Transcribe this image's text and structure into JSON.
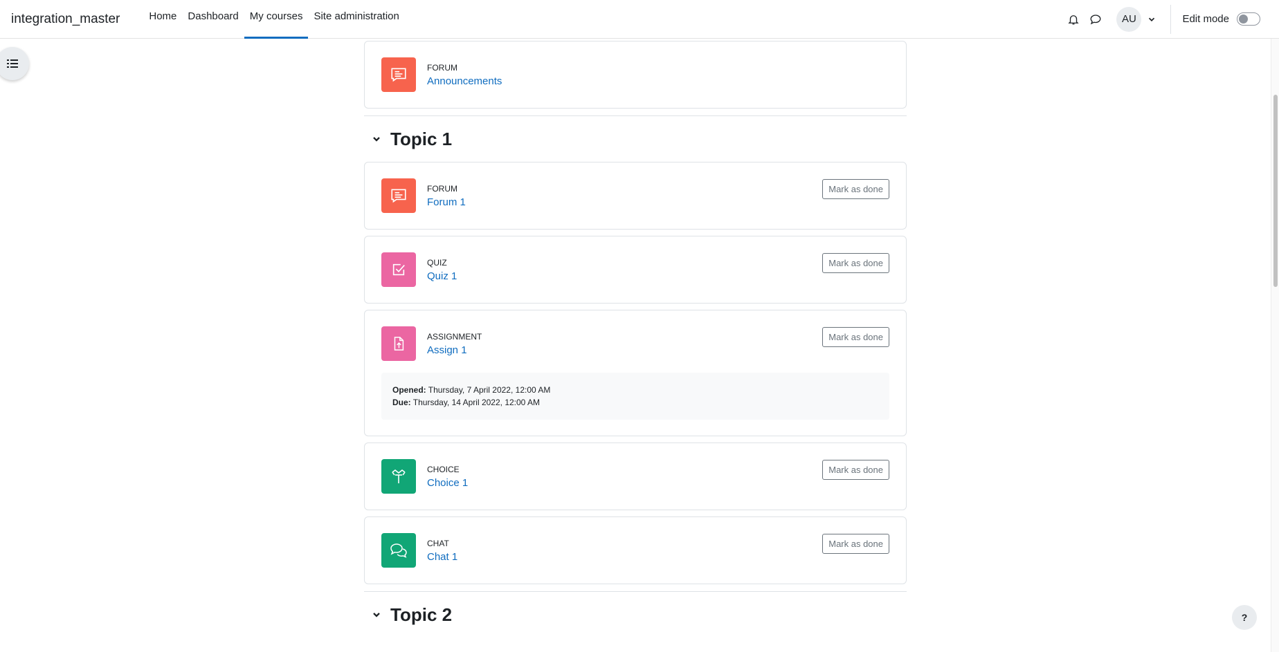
{
  "header": {
    "brand": "integration_master",
    "nav": [
      "Home",
      "Dashboard",
      "My courses",
      "Site administration"
    ],
    "active_nav": "My courses",
    "avatar_initials": "AU",
    "edit_mode_label": "Edit mode"
  },
  "announcement": {
    "type": "FORUM",
    "name": "Announcements",
    "icon": "forum-icon",
    "color": "#f7634d"
  },
  "topic1": {
    "title": "Topic 1",
    "activities": [
      {
        "type": "FORUM",
        "name": "Forum 1",
        "icon": "forum-icon",
        "color": "#f7634d",
        "button": "Mark as done"
      },
      {
        "type": "QUIZ",
        "name": "Quiz 1",
        "icon": "checkbox-icon",
        "color": "#eb66a2",
        "button": "Mark as done"
      },
      {
        "type": "ASSIGNMENT",
        "name": "Assign 1",
        "icon": "file-upload-icon",
        "color": "#eb66a2",
        "button": "Mark as done",
        "opened_label": "Opened:",
        "opened_value": "Thursday, 7 April 2022, 12:00 AM",
        "due_label": "Due:",
        "due_value": "Thursday, 14 April 2022, 12:00 AM"
      },
      {
        "type": "CHOICE",
        "name": "Choice 1",
        "icon": "signpost-icon",
        "color": "#11a676",
        "button": "Mark as done"
      },
      {
        "type": "CHAT",
        "name": "Chat 1",
        "icon": "chat-bubbles-icon",
        "color": "#11a676",
        "button": "Mark as done"
      }
    ]
  },
  "topic2": {
    "title": "Topic 2"
  },
  "help_label": "?"
}
